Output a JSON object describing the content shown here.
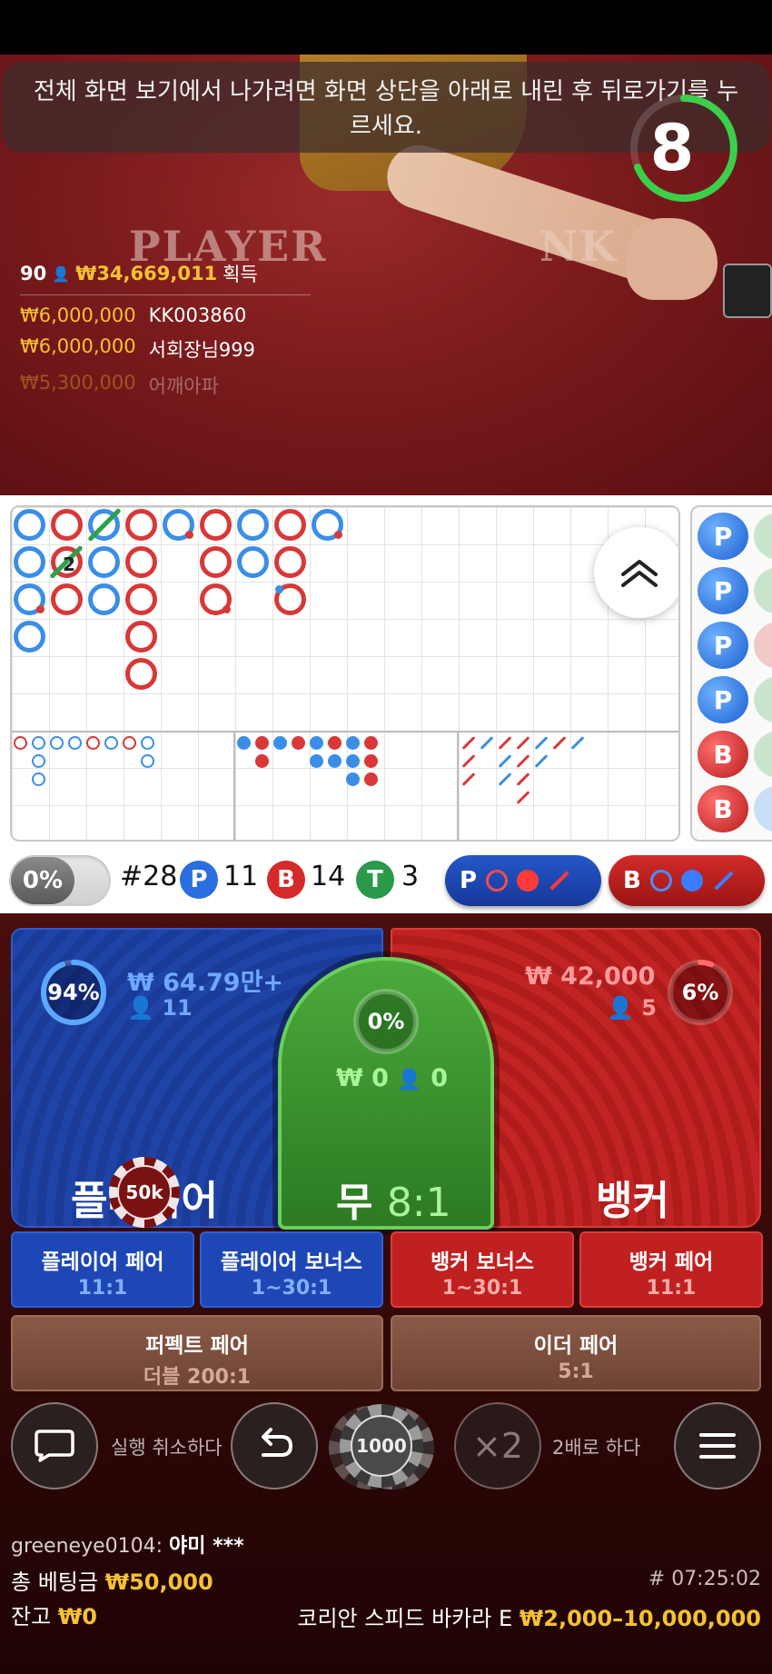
{
  "video": {
    "notice": "전체 화면 보기에서 나가려면 화면 상단을 아래로 내린 후 뒤로가기를 누르세요.",
    "countdown": "8",
    "table_word_left": "PLAYER",
    "table_word_right": "NK",
    "winners": {
      "count": "90",
      "total": "₩34,669,011",
      "total_suffix": "획득",
      "rows": [
        {
          "amount": "₩6,000,000",
          "name": "KK003860"
        },
        {
          "amount": "₩6,000,000",
          "name": "서회장님999"
        },
        {
          "amount": "₩5,300,000",
          "name": "어깨아파"
        }
      ]
    }
  },
  "roadmap": {
    "tie_count_label": "2",
    "predict_labels": [
      "P",
      "P",
      "P",
      "P",
      "B",
      "B"
    ]
  },
  "stats": {
    "percent_toggle": "0%",
    "round": "#28",
    "player_letter": "P",
    "player_count": "11",
    "banker_letter": "B",
    "banker_count": "14",
    "tie_letter": "T",
    "tie_count": "3",
    "ask_player_letter": "P",
    "ask_banker_letter": "B"
  },
  "bets": {
    "player": {
      "percent": "94%",
      "amount": "₩ 64.79만+",
      "players": "11",
      "label": "플레이어",
      "percent_value": 94
    },
    "tie": {
      "percent": "0%",
      "amount": "₩ 0",
      "players": "0",
      "label": "무",
      "odds": "8:1",
      "percent_value": 0
    },
    "banker": {
      "percent": "6%",
      "amount": "₩ 42,000",
      "players": "5",
      "label": "뱅커",
      "percent_value": 6
    },
    "chip_on_player": "50k",
    "side": [
      {
        "title": "플레이어 페어",
        "odds": "11:1"
      },
      {
        "title": "플레이어 보너스",
        "odds": "1~30:1"
      },
      {
        "title": "뱅커 보너스",
        "odds": "1~30:1"
      },
      {
        "title": "뱅커 페어",
        "odds": "11:1"
      }
    ],
    "perfect_pair": {
      "title": "퍼펙트 페어",
      "odds": "더블 200:1"
    },
    "either_pair": {
      "title": "이더 페어",
      "odds": "5:1"
    }
  },
  "controls": {
    "undo_label": "실행 취소하다",
    "chip_value": "1000",
    "double_icon": "×2",
    "double_label": "2배로 하다"
  },
  "footer": {
    "username": "greeneye0104:",
    "chat_msg": "야미 ***",
    "total_bet_label": "총 베팅금",
    "total_bet": "₩50,000",
    "balance_label": "잔고",
    "balance": "₩0",
    "round_id": "# 07:25:02",
    "table_name": "코리안 스피드 바카라 E",
    "limits": "₩2,000–10,000,000"
  },
  "colors": {
    "player": "#1f44a8",
    "banker": "#c22424",
    "tie": "#3f9a32",
    "gold": "#f5c232"
  }
}
